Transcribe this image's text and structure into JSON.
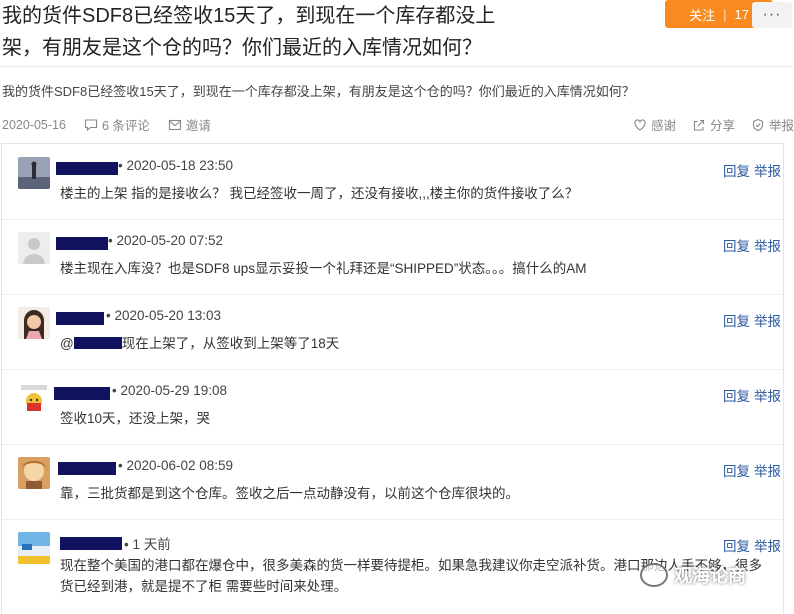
{
  "post": {
    "title": "我的货件SDF8已经签收15天了，到现在一个库存都没上架，有朋友是这个仓的吗？你们最近的入库情况如何？",
    "description": "我的货件SDF8已经签收15天了，到现在一个库存都没上架，有朋友是这个仓的吗？你们最近的入库情况如何？",
    "date": "2020-05-16",
    "comment_count": "6 条评论",
    "invite_label": "邀请",
    "thanks_label": "感谢",
    "share_label": "分享",
    "report_label": "举报"
  },
  "follow": {
    "label": "关注",
    "count": "17"
  },
  "more": {
    "label": "···"
  },
  "comments": [
    {
      "time": "• 2020-05-18 23:50",
      "text": "楼主的上架 指的是接收么？ 我已经签收一周了，还没有接收,,,楼主你的货件接收了么？",
      "reply": "回复",
      "report": "举报"
    },
    {
      "time": "• 2020-05-20 07:52",
      "text": "楼主现在入库没？也是SDF8 ups显示妥投一个礼拜还是“SHIPPED”状态。。。搞什么的AM",
      "reply": "回复",
      "report": "举报"
    },
    {
      "time": "• 2020-05-20 13:03",
      "mention_prefix": "@",
      "text": "现在上架了，从签收到上架等了18天",
      "reply": "回复",
      "report": "举报"
    },
    {
      "time": "• 2020-05-29 19:08",
      "text": "签收10天，还没上架，哭",
      "reply": "回复",
      "report": "举报"
    },
    {
      "time": "• 2020-06-02 08:59",
      "text": "靠，三批货都是到这个仓库。签收之后一点动静没有，以前这个仓库很块的。",
      "reply": "回复",
      "report": "举报"
    },
    {
      "time": "• 1 天前",
      "text": "现在整个美国的港口都在爆仓中，很多美森的货一样要待提柜。如果急我建议你走空派补货。港口那边人手不够，很多货已经到港，就是提不了柜 需要些时间来处理。",
      "reply": "回复",
      "report": "举报"
    }
  ],
  "watermark": {
    "text": "观海论商"
  },
  "colors": {
    "accent": "#f98a1f",
    "link": "#2c5aa0",
    "redaction": "#12135f"
  }
}
